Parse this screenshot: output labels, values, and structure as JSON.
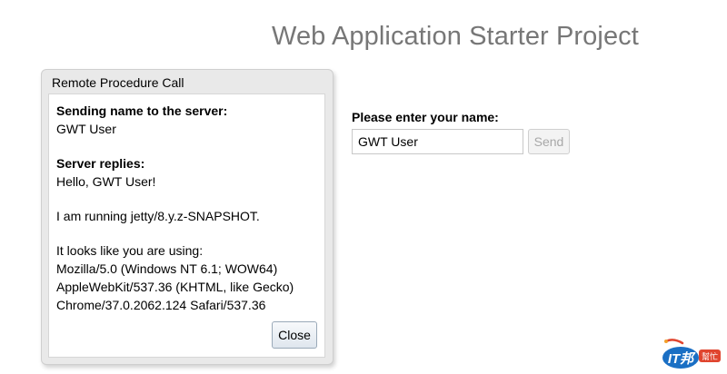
{
  "page": {
    "title": "Web Application Starter Project"
  },
  "dialog": {
    "caption": "Remote Procedure Call",
    "sending_heading": "Sending name to the server:",
    "sent_name": "GWT User",
    "replies_heading": "Server replies:",
    "reply_greeting": "Hello, GWT User!",
    "server_info": "I am running jetty/8.y.z-SNAPSHOT.",
    "agent_intro": "It looks like you are using:",
    "user_agent_lines": [
      "Mozilla/5.0 (Windows NT 6.1; WOW64)",
      "AppleWebKit/537.36 (KHTML, like Gecko)",
      "Chrome/37.0.2062.124 Safari/537.36"
    ],
    "close_label": "Close"
  },
  "form": {
    "prompt": "Please enter your name:",
    "name_value": "GWT User",
    "send_label": "Send"
  },
  "watermark": {
    "icon": "ithome-logo",
    "text": "IT邦",
    "subtext": "幫忙",
    "colors": {
      "primary": "#1a6fc4",
      "accent": "#e0452f"
    }
  }
}
